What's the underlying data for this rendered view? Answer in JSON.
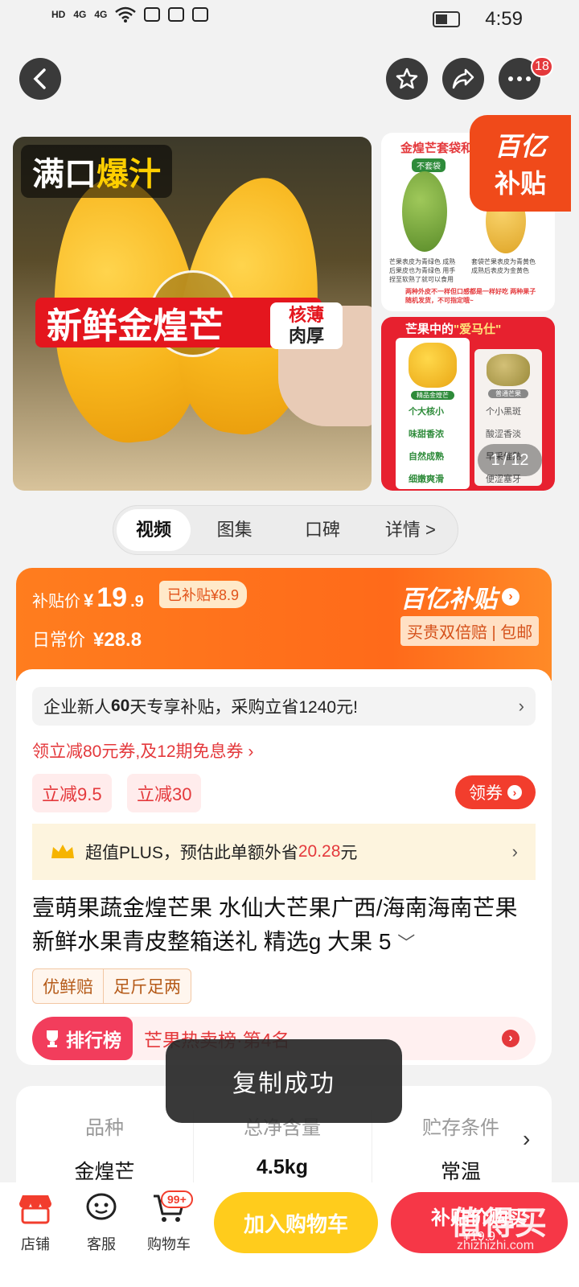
{
  "status": {
    "left_icons": [
      "HD",
      "4G",
      "4G",
      "wifi"
    ],
    "time": "4:59"
  },
  "header": {
    "more_badge": "18"
  },
  "gallery": {
    "hero_tag_white": "满口",
    "hero_tag_yellow": "爆汁",
    "hero_title": "新鲜金煌芒",
    "hero_side_tag_1": "核薄",
    "hero_side_tag_2": "肉厚",
    "side1_title": "金煌芒套袋和不",
    "side1_label": "不套袋",
    "side1_text_left": "芒果表皮为青绿色 成熟后果皮也为青绿色 用手捏至软熟了就可以食用",
    "side1_text_right": "套袋芒果表皮为青黄色 成熟后表皮为金黄色",
    "side1_footer": "两种外皮不一样但口感都是一样好吃 两种果子随机发货，不可指定哦~",
    "side2_title_white": "芒果中的",
    "side2_title_yellow": "\"爱马仕\"",
    "side2_label_left": "精品金煌芒",
    "side2_label_right": "普通芒果",
    "side2_features_left": [
      "个大核小",
      "味甜香浓",
      "自然成熟",
      "细嫩爽滑"
    ],
    "side2_features_right": [
      "个小黑斑",
      "酸涩香淡",
      "早采催熟",
      "便涩塞牙"
    ],
    "subsidy_l1": "百亿",
    "subsidy_l2": "补贴",
    "counter_current": "1",
    "counter_total": "12"
  },
  "tabs": [
    "视频",
    "图集",
    "口碑",
    "详情 >"
  ],
  "price": {
    "subsidy_label": "补贴价",
    "subsidy_symbol": "¥",
    "subsidy_int": "19",
    "subsidy_dec": ".9",
    "subsidized_tag": "已补贴¥8.9",
    "daily_label": "日常价",
    "daily_value": "¥28.8",
    "brand": "百亿补贴",
    "guarantee": "买贵双倍赔 | 包邮"
  },
  "promo": {
    "enterprise_prefix": "企业新人",
    "enterprise_days": "60",
    "enterprise_suffix": "天专享补贴，采购立省1240元!",
    "coupon_line": "领立减80元券,及12期免息券 ›",
    "coupons": [
      "立减9.5",
      "立减30"
    ],
    "claim_button": "领券",
    "plus_prefix": "超值PLUS，预估此单额外省",
    "plus_amount": "20.28",
    "plus_suffix": "元"
  },
  "product": {
    "title": "壹萌果蔬金煌芒果 水仙大芒果广西/海南海南芒果新鲜水果青皮整箱送礼 精选g 大果 5",
    "tags": [
      "优鲜赔",
      "足斤足两"
    ],
    "rank_badge": "排行榜",
    "rank_text": "芒果热卖榜·第4名"
  },
  "specs": [
    {
      "label": "品种",
      "value": "金煌芒"
    },
    {
      "label": "总净含量",
      "value": "4.5kg"
    },
    {
      "label": "贮存条件",
      "value": "常温"
    }
  ],
  "toast": "复制成功",
  "bottom": {
    "store": "店铺",
    "service": "客服",
    "cart": "购物车",
    "cart_badge": "99+",
    "add_cart": "加入购物车",
    "buy": "补贴价购买",
    "buy_price": "¥19.9",
    "watermark": "值得买",
    "watermark_url": "zhizhizhi.com"
  }
}
